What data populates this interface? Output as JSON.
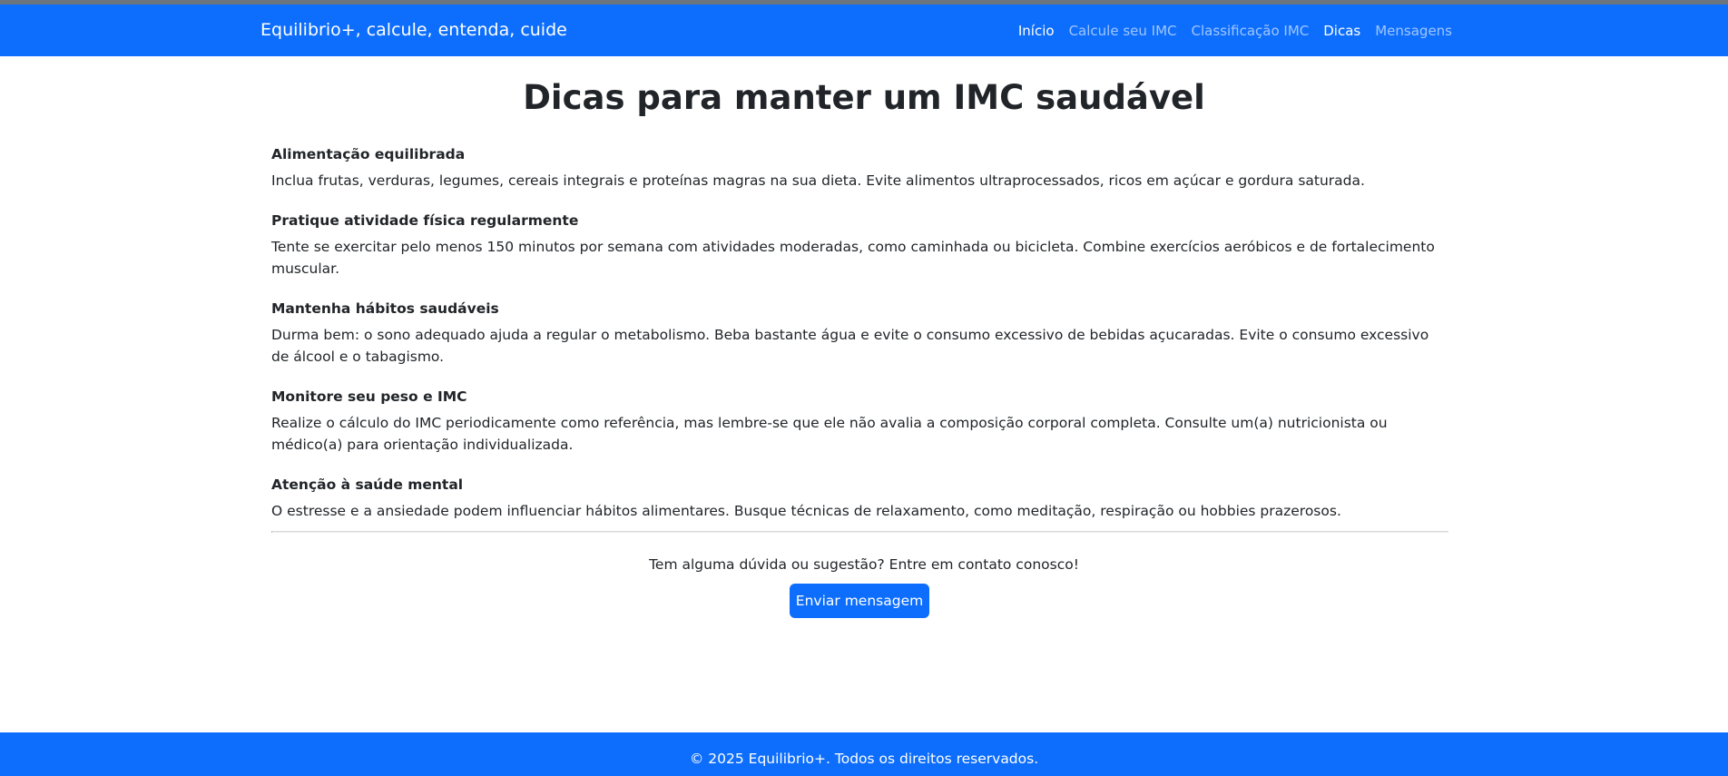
{
  "navbar": {
    "brand": "Equilibrio+, calcule, entenda, cuide",
    "links": [
      "Início",
      "Calcule seu IMC",
      "Classificação IMC",
      "Dicas",
      "Mensagens"
    ]
  },
  "page_title": "Dicas para manter um IMC saudável",
  "tips": [
    {
      "title": "Alimentação equilibrada",
      "text": "Inclua frutas, verduras, legumes, cereais integrais e proteínas magras na sua dieta. Evite alimentos ultraprocessados, ricos em açúcar e gordura saturada."
    },
    {
      "title": "Pratique atividade física regularmente",
      "text": "Tente se exercitar pelo menos 150 minutos por semana com atividades moderadas, como caminhada ou bicicleta. Combine exercícios aeróbicos e de fortalecimento muscular."
    },
    {
      "title": "Mantenha hábitos saudáveis",
      "text": "Durma bem: o sono adequado ajuda a regular o metabolismo. Beba bastante água e evite o consumo excessivo de bebidas açucaradas. Evite o consumo excessivo de álcool e o tabagismo."
    },
    {
      "title": "Monitore seu peso e IMC",
      "text": "Realize o cálculo do IMC periodicamente como referência, mas lembre-se que ele não avalia a composição corporal completa. Consulte um(a) nutricionista ou médico(a) para orientação individualizada."
    },
    {
      "title": "Atenção à saúde mental",
      "text": "O estresse e a ansiedade podem influenciar hábitos alimentares. Busque técnicas de relaxamento, como meditação, respiração ou hobbies prazerosos."
    }
  ],
  "contact": {
    "text": "Tem alguma dúvida ou sugestão? Entre em contato conosco!",
    "button_label": "Enviar mensagem"
  },
  "footer": {
    "text": "© 2025 Equilibrio+. Todos os direitos reservados."
  },
  "colors": {
    "primary": "#0d6efd",
    "text": "#212529"
  }
}
